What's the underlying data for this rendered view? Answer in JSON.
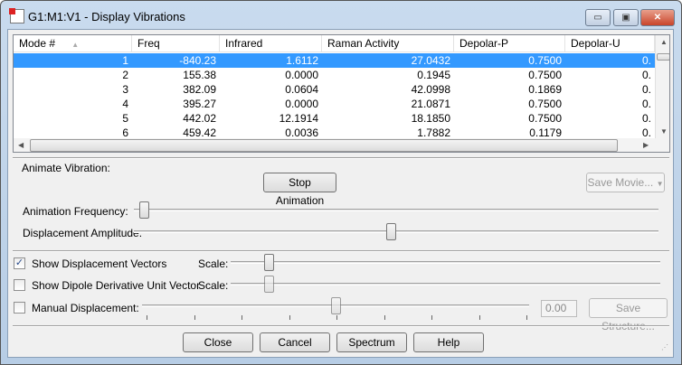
{
  "window": {
    "title": "G1:M1:V1 - Display Vibrations",
    "minimize": "▭",
    "maximize": "▣",
    "close": "✕"
  },
  "table": {
    "columns": [
      "Mode #",
      "Freq",
      "Infrared",
      "Raman Activity",
      "Depolar-P",
      "Depolar-U"
    ],
    "rows": [
      [
        "1",
        "-840.23",
        "1.6112",
        "27.0432",
        "0.7500",
        "0."
      ],
      [
        "2",
        "155.38",
        "0.0000",
        "0.1945",
        "0.7500",
        "0."
      ],
      [
        "3",
        "382.09",
        "0.0604",
        "42.0998",
        "0.1869",
        "0."
      ],
      [
        "4",
        "395.27",
        "0.0000",
        "21.0871",
        "0.7500",
        "0."
      ],
      [
        "5",
        "442.02",
        "12.1914",
        "18.1850",
        "0.7500",
        "0."
      ],
      [
        "6",
        "459.42",
        "0.0036",
        "1.7882",
        "0.1179",
        "0."
      ]
    ],
    "selected_row": 0
  },
  "animate": {
    "label": "Animate Vibration:",
    "stop_button": "Stop Animation",
    "save_movie": "Save Movie...",
    "frequency_label": "Animation Frequency:",
    "amplitude_label": "Displacement Amplitude:",
    "frequency_value": 0.01,
    "amplitude_value": 0.49
  },
  "options": {
    "show_vectors": {
      "label": "Show Displacement Vectors",
      "checked": true,
      "scale_label": "Scale:",
      "scale_value": 0.08
    },
    "show_dipole": {
      "label": "Show Dipole Derivative Unit Vector",
      "checked": false,
      "scale_label": "Scale:",
      "scale_value": 0.08
    },
    "manual": {
      "label": "Manual Displacement:",
      "checked": false,
      "value": "0.00",
      "slider_value": 0.5,
      "save_button": "Save Structure..."
    }
  },
  "buttons": {
    "close": "Close",
    "cancel": "Cancel",
    "spectrum": "Spectrum",
    "help": "Help"
  }
}
